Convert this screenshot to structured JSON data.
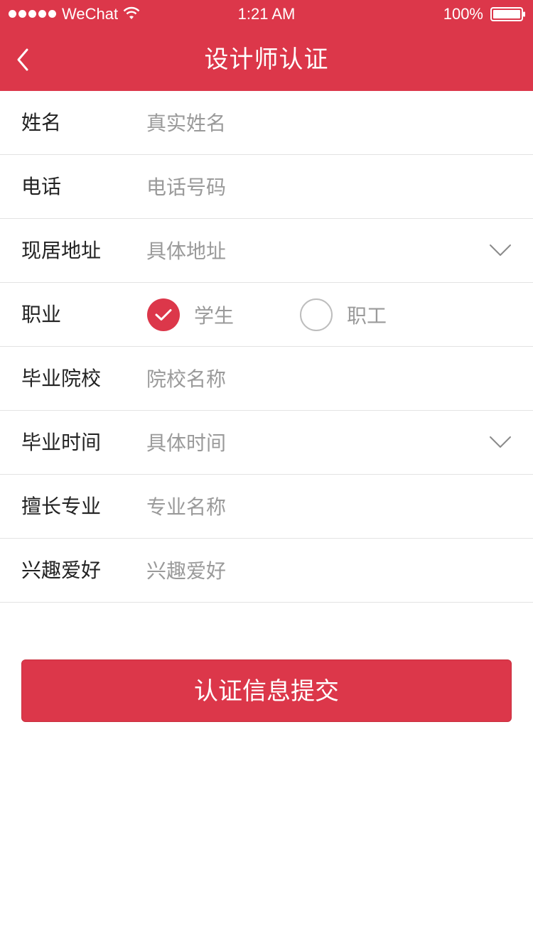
{
  "status_bar": {
    "carrier": "WeChat",
    "time": "1:21 AM",
    "battery": "100%"
  },
  "nav": {
    "title": "设计师认证",
    "back_icon": "chevron-left-icon"
  },
  "form": {
    "name": {
      "label": "姓名",
      "placeholder": "真实姓名",
      "value": ""
    },
    "phone": {
      "label": "电话",
      "placeholder": "电话号码",
      "value": ""
    },
    "address": {
      "label": "现居地址",
      "placeholder": "具体地址",
      "value": ""
    },
    "occupation": {
      "label": "职业",
      "options": [
        {
          "label": "学生",
          "selected": true
        },
        {
          "label": "职工",
          "selected": false
        }
      ]
    },
    "school": {
      "label": "毕业院校",
      "placeholder": "院校名称",
      "value": ""
    },
    "grad_time": {
      "label": "毕业时间",
      "placeholder": "具体时间",
      "value": ""
    },
    "specialty": {
      "label": "擅长专业",
      "placeholder": "专业名称",
      "value": ""
    },
    "hobbies": {
      "label": "兴趣爱好",
      "placeholder": "兴趣爱好",
      "value": ""
    }
  },
  "submit": {
    "label": "认证信息提交"
  },
  "colors": {
    "accent": "#dc374a",
    "divider": "#e3e3e3",
    "placeholder": "#9a9a9a",
    "label": "#222222"
  }
}
